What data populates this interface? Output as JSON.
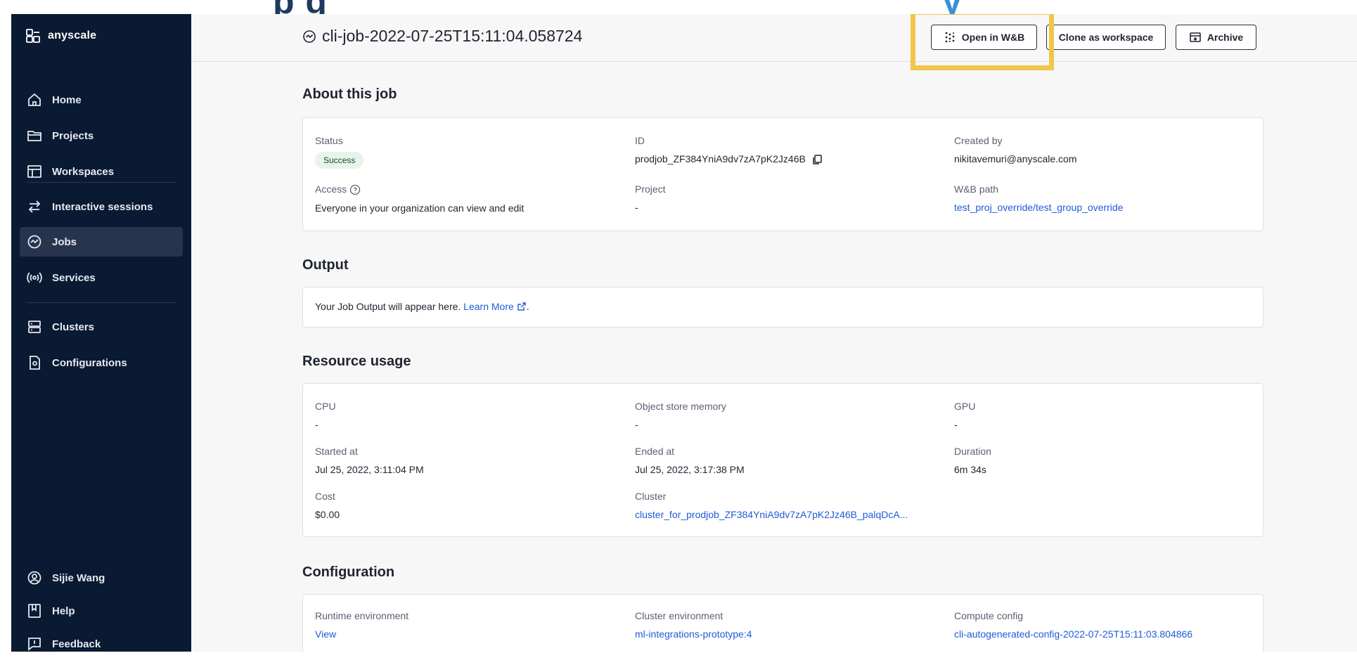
{
  "banner": {
    "left_text": "p g",
    "right_text": "y"
  },
  "brand": {
    "name": "anyscale"
  },
  "sidebar": {
    "items": [
      {
        "label": "Home",
        "icon": "home-icon"
      },
      {
        "label": "Projects",
        "icon": "folder-icon"
      },
      {
        "label": "Workspaces",
        "icon": "workspace-icon"
      },
      {
        "label": "Interactive sessions",
        "icon": "arrows-icon"
      },
      {
        "label": "Jobs",
        "icon": "jobs-icon",
        "active": true
      },
      {
        "label": "Services",
        "icon": "broadcast-icon"
      },
      {
        "label": "Clusters",
        "icon": "server-icon"
      },
      {
        "label": "Configurations",
        "icon": "config-file-icon"
      }
    ],
    "bottom": [
      {
        "label": "Sijie Wang",
        "icon": "user-icon"
      },
      {
        "label": "Help",
        "icon": "book-icon"
      },
      {
        "label": "Feedback",
        "icon": "feedback-icon"
      }
    ]
  },
  "header": {
    "title": "cli-job-2022-07-25T15:11:04.058724",
    "buttons": {
      "open_wandb": "Open in W&B",
      "clone": "Clone as workspace",
      "archive": "Archive"
    }
  },
  "about": {
    "title": "About this job",
    "status": {
      "label": "Status",
      "value": "Success"
    },
    "id": {
      "label": "ID",
      "value": "prodjob_ZF384YniA9dv7zA7pK2Jz46B"
    },
    "created_by": {
      "label": "Created by",
      "value": "nikitavemuri@anyscale.com"
    },
    "access": {
      "label": "Access",
      "value": "Everyone in your organization can view and edit"
    },
    "project": {
      "label": "Project",
      "value": "-"
    },
    "wandb_path": {
      "label": "W&B path",
      "value": "test_proj_override/test_group_override"
    }
  },
  "output": {
    "title": "Output",
    "text": "Your Job Output will appear here.",
    "link": "Learn More",
    "suffix": "."
  },
  "resources": {
    "title": "Resource usage",
    "cpu": {
      "label": "CPU",
      "value": "-"
    },
    "object_store": {
      "label": "Object store memory",
      "value": "-"
    },
    "gpu": {
      "label": "GPU",
      "value": "-"
    },
    "started": {
      "label": "Started at",
      "value": "Jul 25, 2022, 3:11:04 PM"
    },
    "ended": {
      "label": "Ended at",
      "value": "Jul 25, 2022, 3:17:38 PM"
    },
    "duration": {
      "label": "Duration",
      "value": "6m 34s"
    },
    "cost": {
      "label": "Cost",
      "value": "$0.00"
    },
    "cluster": {
      "label": "Cluster",
      "value": "cluster_for_prodjob_ZF384YniA9dv7zA7pK2Jz46B_palqDcA..."
    }
  },
  "configuration": {
    "title": "Configuration",
    "runtime": {
      "label": "Runtime environment",
      "value": "View"
    },
    "cluster_env": {
      "label": "Cluster environment",
      "value": "ml-integrations-prototype:4"
    },
    "compute": {
      "label": "Compute config",
      "value": "cli-autogenerated-config-2022-07-25T15:11:03.804866"
    }
  },
  "colors": {
    "sidebar_bg": "#0a1a33",
    "active_item_bg": "#26344d",
    "link": "#1f5bd8",
    "highlight": "#f0c64a",
    "success_badge_bg": "#e6f4ea"
  }
}
